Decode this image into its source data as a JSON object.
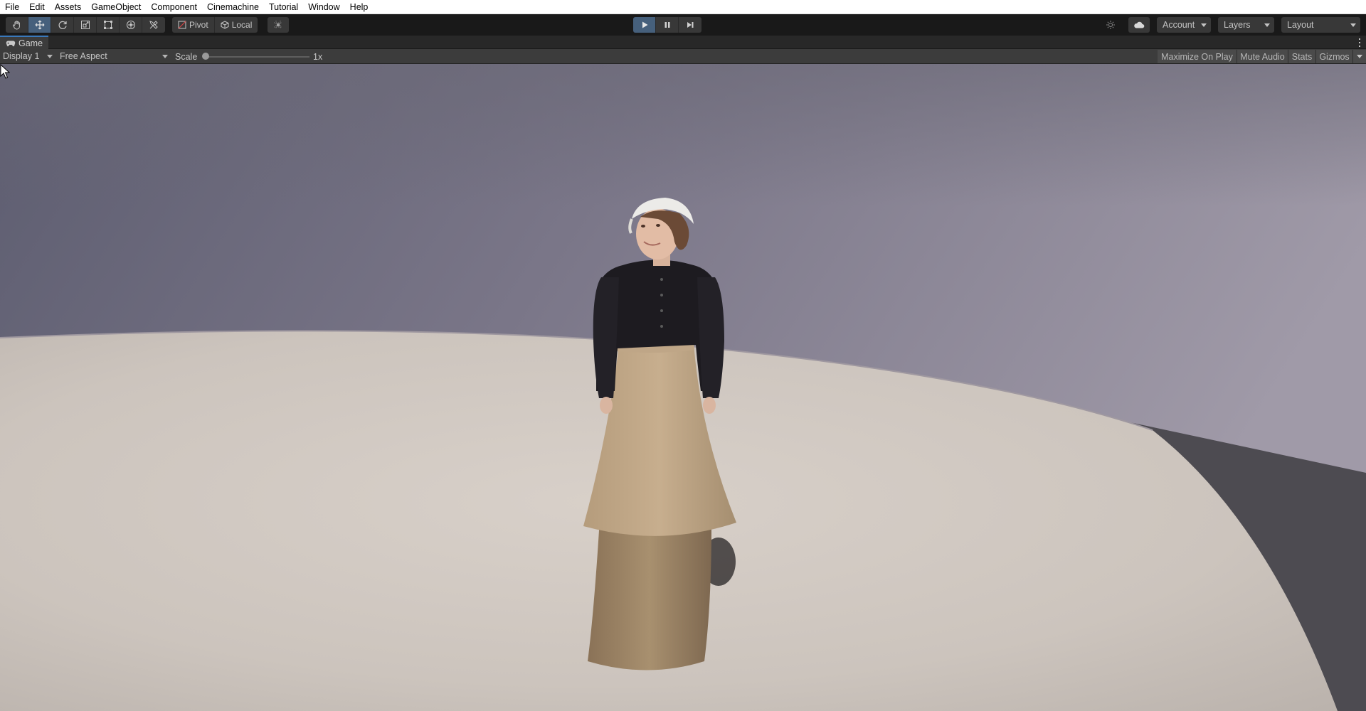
{
  "menu": [
    "File",
    "Edit",
    "Assets",
    "GameObject",
    "Component",
    "Cinemachine",
    "Tutorial",
    "Window",
    "Help"
  ],
  "toolbar": {
    "tools": [
      {
        "name": "hand-tool",
        "icon": "hand-icon",
        "active": false
      },
      {
        "name": "move-tool",
        "icon": "move-icon",
        "active": true
      },
      {
        "name": "rotate-tool",
        "icon": "rotate-icon",
        "active": false
      },
      {
        "name": "scale-tool",
        "icon": "scale-icon",
        "active": false
      },
      {
        "name": "rect-tool",
        "icon": "rect-icon",
        "active": false
      },
      {
        "name": "transform-tool",
        "icon": "transform-icon",
        "active": false
      },
      {
        "name": "custom-tool",
        "icon": "tools-icon",
        "active": false
      }
    ],
    "pivot_label": "Pivot",
    "local_label": "Local",
    "account_label": "Account",
    "layers_label": "Layers",
    "layout_label": "Layout",
    "play_state": "playing"
  },
  "game_tab": {
    "title": "Game"
  },
  "game_toolbar": {
    "display": "Display 1",
    "aspect": "Free Aspect",
    "scale_label": "Scale",
    "scale_value": "1x",
    "maximize_on_play": "Maximize On Play",
    "mute_audio": "Mute Audio",
    "stats": "Stats",
    "gizmos": "Gizmos"
  },
  "colors": {
    "accent": "#46607c",
    "tab_highlight": "#3a79bb",
    "editor_bg": "#191919"
  }
}
